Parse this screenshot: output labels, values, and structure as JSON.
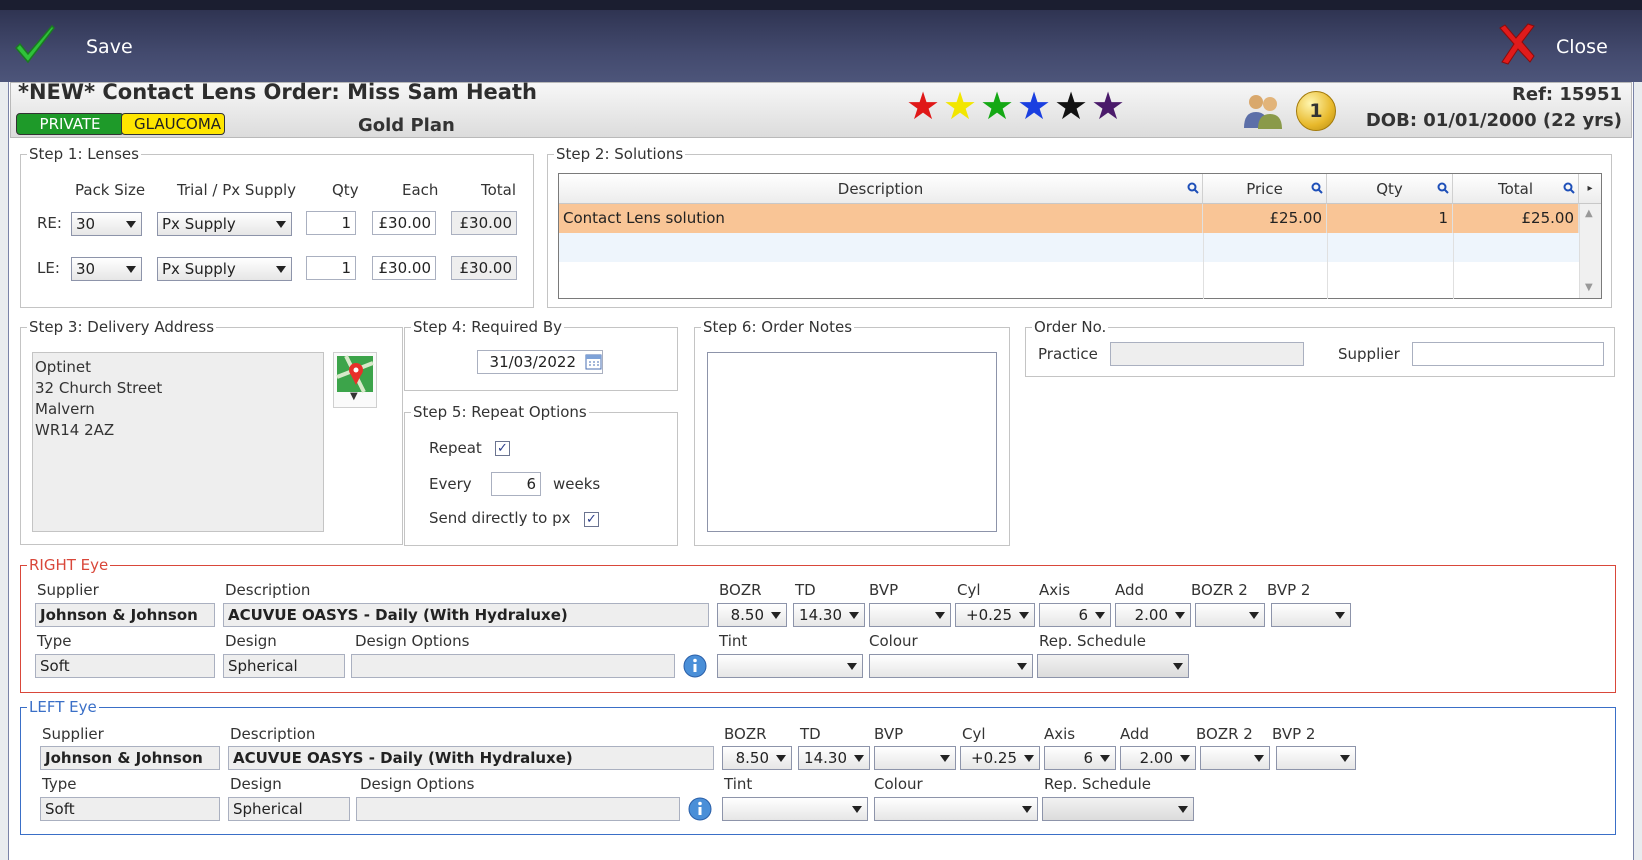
{
  "toolbar": {
    "save_label": "Save",
    "close_label": "Close"
  },
  "header": {
    "title": "*NEW* Contact Lens Order: Miss Sam Heath",
    "tags": {
      "private": "PRIVATE",
      "glaucoma": "GLAUCOMA"
    },
    "plan": "Gold Plan",
    "ref": "Ref: 15951",
    "dob": "DOB: 01/01/2000 (22 yrs)",
    "badge_count": "1",
    "stars": [
      "#e01818",
      "#f2e600",
      "#14a814",
      "#1a3fe0",
      "#111111",
      "#4a1a6a"
    ]
  },
  "lenses": {
    "legend": "Step 1: Lenses",
    "headers": {
      "pack": "Pack Size",
      "trial": "Trial / Px Supply",
      "qty": "Qty",
      "each": "Each",
      "total": "Total"
    },
    "re": {
      "label": "RE:",
      "pack": "30",
      "supply": "Px Supply",
      "qty": "1",
      "each": "£30.00",
      "total": "£30.00"
    },
    "le": {
      "label": "LE:",
      "pack": "30",
      "supply": "Px Supply",
      "qty": "1",
      "each": "£30.00",
      "total": "£30.00"
    }
  },
  "solutions": {
    "legend": "Step 2: Solutions",
    "columns": {
      "description": "Description",
      "price": "Price",
      "qty": "Qty",
      "total": "Total"
    },
    "rows": [
      {
        "description": "Contact Lens solution",
        "price": "£25.00",
        "qty": "1",
        "total": "£25.00"
      }
    ]
  },
  "delivery": {
    "legend": "Step 3: Delivery Address",
    "lines": [
      "Optinet",
      "32 Church Street",
      "Malvern",
      "WR14 2AZ"
    ]
  },
  "required": {
    "legend": "Step 4: Required By",
    "date": "31/03/2022"
  },
  "repeat": {
    "legend": "Step 5: Repeat Options",
    "repeat_label": "Repeat",
    "repeat_checked": "✓",
    "every_label": "Every",
    "every_value": "6",
    "weeks_label": "weeks",
    "send_label": "Send directly to px",
    "send_checked": "✓"
  },
  "notes": {
    "legend": "Step 6: Order Notes"
  },
  "order_no": {
    "legend": "Order No.",
    "practice_label": "Practice",
    "supplier_label": "Supplier"
  },
  "labels": {
    "supplier": "Supplier",
    "description": "Description",
    "bozr": "BOZR",
    "td": "TD",
    "bvp": "BVP",
    "cyl": "Cyl",
    "axis": "Axis",
    "add": "Add",
    "bozr2": "BOZR 2",
    "bvp2": "BVP 2",
    "type": "Type",
    "design": "Design",
    "design_options": "Design Options",
    "tint": "Tint",
    "colour": "Colour",
    "rep_schedule": "Rep. Schedule"
  },
  "right_eye": {
    "legend": "RIGHT Eye",
    "color": "#d9473a",
    "supplier": "Johnson & Johnson",
    "description": "ACUVUE OASYS - Daily  (With Hydraluxe)",
    "bozr": "8.50",
    "td": "14.30",
    "bvp": "",
    "cyl": "+0.25",
    "axis": "6",
    "add": "2.00",
    "bozr2": "",
    "bvp2": "",
    "type": "Soft",
    "design": "Spherical"
  },
  "left_eye": {
    "legend": "LEFT Eye",
    "color": "#3a6fc7",
    "supplier": "Johnson & Johnson",
    "description": "ACUVUE OASYS - Daily  (With Hydraluxe)",
    "bozr": "8.50",
    "td": "14.30",
    "bvp": "",
    "cyl": "+0.25",
    "axis": "6",
    "add": "2.00",
    "bozr2": "",
    "bvp2": "",
    "type": "Soft",
    "design": "Spherical"
  }
}
